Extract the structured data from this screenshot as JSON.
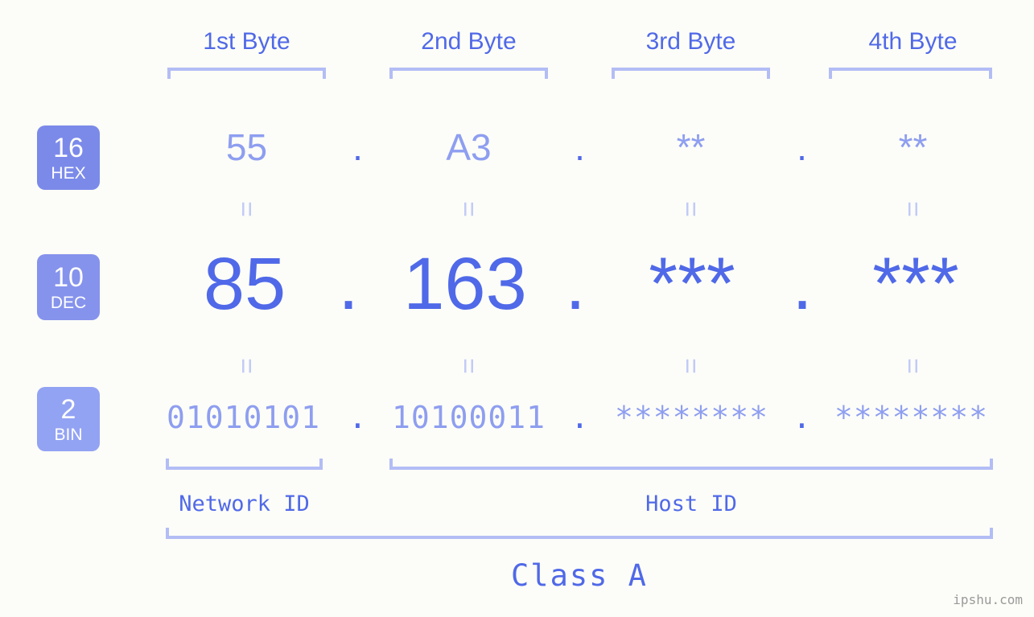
{
  "background_color": "#fcfdf8",
  "colors": {
    "accent_strong": "#5069e8",
    "accent_light": "#8e9ef0",
    "bracket": "#b3bdf5",
    "equals": "#c2cbf7",
    "badge_hex": "#7b8ae9",
    "badge_dec": "#8593ec",
    "badge_bin": "#93a3f3",
    "watermark": "#9a9a9a"
  },
  "byte_headers": [
    {
      "label": "1st Byte"
    },
    {
      "label": "2nd Byte"
    },
    {
      "label": "3rd Byte"
    },
    {
      "label": "4th Byte"
    }
  ],
  "radix_badges": [
    {
      "num": "16",
      "name": "HEX"
    },
    {
      "num": "10",
      "name": "DEC"
    },
    {
      "num": "2",
      "name": "BIN"
    }
  ],
  "separator": ".",
  "rows": {
    "hex": {
      "radix": "16",
      "radix_name": "HEX",
      "octets": [
        "55",
        "A3",
        "**",
        "**"
      ]
    },
    "dec": {
      "radix": "10",
      "radix_name": "DEC",
      "octets": [
        "85",
        "163",
        "***",
        "***"
      ]
    },
    "bin": {
      "radix": "2",
      "radix_name": "BIN",
      "octets": [
        "01010101",
        "10100011",
        "********",
        "********"
      ]
    }
  },
  "equals_symbol": "=",
  "id_labels": {
    "network": "Network ID",
    "host": "Host ID"
  },
  "class_label": "Class A",
  "watermark": "ipshu.com"
}
